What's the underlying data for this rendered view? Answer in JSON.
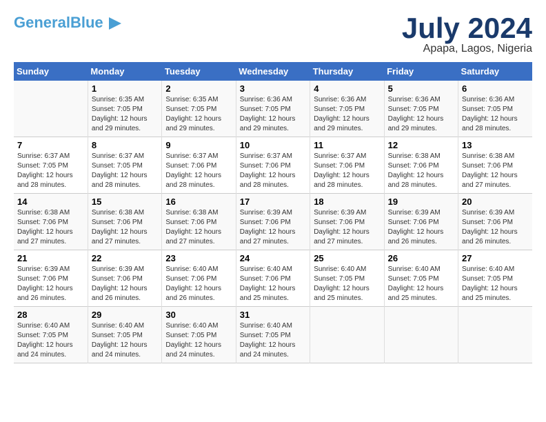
{
  "header": {
    "logo_general": "General",
    "logo_blue": "Blue",
    "month_year": "July 2024",
    "location": "Apapa, Lagos, Nigeria"
  },
  "weekdays": [
    "Sunday",
    "Monday",
    "Tuesday",
    "Wednesday",
    "Thursday",
    "Friday",
    "Saturday"
  ],
  "weeks": [
    [
      {
        "day": "",
        "sunrise": "",
        "sunset": "",
        "daylight": ""
      },
      {
        "day": "1",
        "sunrise": "Sunrise: 6:35 AM",
        "sunset": "Sunset: 7:05 PM",
        "daylight": "Daylight: 12 hours and 29 minutes."
      },
      {
        "day": "2",
        "sunrise": "Sunrise: 6:35 AM",
        "sunset": "Sunset: 7:05 PM",
        "daylight": "Daylight: 12 hours and 29 minutes."
      },
      {
        "day": "3",
        "sunrise": "Sunrise: 6:36 AM",
        "sunset": "Sunset: 7:05 PM",
        "daylight": "Daylight: 12 hours and 29 minutes."
      },
      {
        "day": "4",
        "sunrise": "Sunrise: 6:36 AM",
        "sunset": "Sunset: 7:05 PM",
        "daylight": "Daylight: 12 hours and 29 minutes."
      },
      {
        "day": "5",
        "sunrise": "Sunrise: 6:36 AM",
        "sunset": "Sunset: 7:05 PM",
        "daylight": "Daylight: 12 hours and 29 minutes."
      },
      {
        "day": "6",
        "sunrise": "Sunrise: 6:36 AM",
        "sunset": "Sunset: 7:05 PM",
        "daylight": "Daylight: 12 hours and 28 minutes."
      }
    ],
    [
      {
        "day": "7",
        "sunrise": "Sunrise: 6:37 AM",
        "sunset": "Sunset: 7:05 PM",
        "daylight": "Daylight: 12 hours and 28 minutes."
      },
      {
        "day": "8",
        "sunrise": "Sunrise: 6:37 AM",
        "sunset": "Sunset: 7:05 PM",
        "daylight": "Daylight: 12 hours and 28 minutes."
      },
      {
        "day": "9",
        "sunrise": "Sunrise: 6:37 AM",
        "sunset": "Sunset: 7:06 PM",
        "daylight": "Daylight: 12 hours and 28 minutes."
      },
      {
        "day": "10",
        "sunrise": "Sunrise: 6:37 AM",
        "sunset": "Sunset: 7:06 PM",
        "daylight": "Daylight: 12 hours and 28 minutes."
      },
      {
        "day": "11",
        "sunrise": "Sunrise: 6:37 AM",
        "sunset": "Sunset: 7:06 PM",
        "daylight": "Daylight: 12 hours and 28 minutes."
      },
      {
        "day": "12",
        "sunrise": "Sunrise: 6:38 AM",
        "sunset": "Sunset: 7:06 PM",
        "daylight": "Daylight: 12 hours and 28 minutes."
      },
      {
        "day": "13",
        "sunrise": "Sunrise: 6:38 AM",
        "sunset": "Sunset: 7:06 PM",
        "daylight": "Daylight: 12 hours and 27 minutes."
      }
    ],
    [
      {
        "day": "14",
        "sunrise": "Sunrise: 6:38 AM",
        "sunset": "Sunset: 7:06 PM",
        "daylight": "Daylight: 12 hours and 27 minutes."
      },
      {
        "day": "15",
        "sunrise": "Sunrise: 6:38 AM",
        "sunset": "Sunset: 7:06 PM",
        "daylight": "Daylight: 12 hours and 27 minutes."
      },
      {
        "day": "16",
        "sunrise": "Sunrise: 6:38 AM",
        "sunset": "Sunset: 7:06 PM",
        "daylight": "Daylight: 12 hours and 27 minutes."
      },
      {
        "day": "17",
        "sunrise": "Sunrise: 6:39 AM",
        "sunset": "Sunset: 7:06 PM",
        "daylight": "Daylight: 12 hours and 27 minutes."
      },
      {
        "day": "18",
        "sunrise": "Sunrise: 6:39 AM",
        "sunset": "Sunset: 7:06 PM",
        "daylight": "Daylight: 12 hours and 27 minutes."
      },
      {
        "day": "19",
        "sunrise": "Sunrise: 6:39 AM",
        "sunset": "Sunset: 7:06 PM",
        "daylight": "Daylight: 12 hours and 26 minutes."
      },
      {
        "day": "20",
        "sunrise": "Sunrise: 6:39 AM",
        "sunset": "Sunset: 7:06 PM",
        "daylight": "Daylight: 12 hours and 26 minutes."
      }
    ],
    [
      {
        "day": "21",
        "sunrise": "Sunrise: 6:39 AM",
        "sunset": "Sunset: 7:06 PM",
        "daylight": "Daylight: 12 hours and 26 minutes."
      },
      {
        "day": "22",
        "sunrise": "Sunrise: 6:39 AM",
        "sunset": "Sunset: 7:06 PM",
        "daylight": "Daylight: 12 hours and 26 minutes."
      },
      {
        "day": "23",
        "sunrise": "Sunrise: 6:40 AM",
        "sunset": "Sunset: 7:06 PM",
        "daylight": "Daylight: 12 hours and 26 minutes."
      },
      {
        "day": "24",
        "sunrise": "Sunrise: 6:40 AM",
        "sunset": "Sunset: 7:06 PM",
        "daylight": "Daylight: 12 hours and 25 minutes."
      },
      {
        "day": "25",
        "sunrise": "Sunrise: 6:40 AM",
        "sunset": "Sunset: 7:05 PM",
        "daylight": "Daylight: 12 hours and 25 minutes."
      },
      {
        "day": "26",
        "sunrise": "Sunrise: 6:40 AM",
        "sunset": "Sunset: 7:05 PM",
        "daylight": "Daylight: 12 hours and 25 minutes."
      },
      {
        "day": "27",
        "sunrise": "Sunrise: 6:40 AM",
        "sunset": "Sunset: 7:05 PM",
        "daylight": "Daylight: 12 hours and 25 minutes."
      }
    ],
    [
      {
        "day": "28",
        "sunrise": "Sunrise: 6:40 AM",
        "sunset": "Sunset: 7:05 PM",
        "daylight": "Daylight: 12 hours and 24 minutes."
      },
      {
        "day": "29",
        "sunrise": "Sunrise: 6:40 AM",
        "sunset": "Sunset: 7:05 PM",
        "daylight": "Daylight: 12 hours and 24 minutes."
      },
      {
        "day": "30",
        "sunrise": "Sunrise: 6:40 AM",
        "sunset": "Sunset: 7:05 PM",
        "daylight": "Daylight: 12 hours and 24 minutes."
      },
      {
        "day": "31",
        "sunrise": "Sunrise: 6:40 AM",
        "sunset": "Sunset: 7:05 PM",
        "daylight": "Daylight: 12 hours and 24 minutes."
      },
      {
        "day": "",
        "sunrise": "",
        "sunset": "",
        "daylight": ""
      },
      {
        "day": "",
        "sunrise": "",
        "sunset": "",
        "daylight": ""
      },
      {
        "day": "",
        "sunrise": "",
        "sunset": "",
        "daylight": ""
      }
    ]
  ]
}
